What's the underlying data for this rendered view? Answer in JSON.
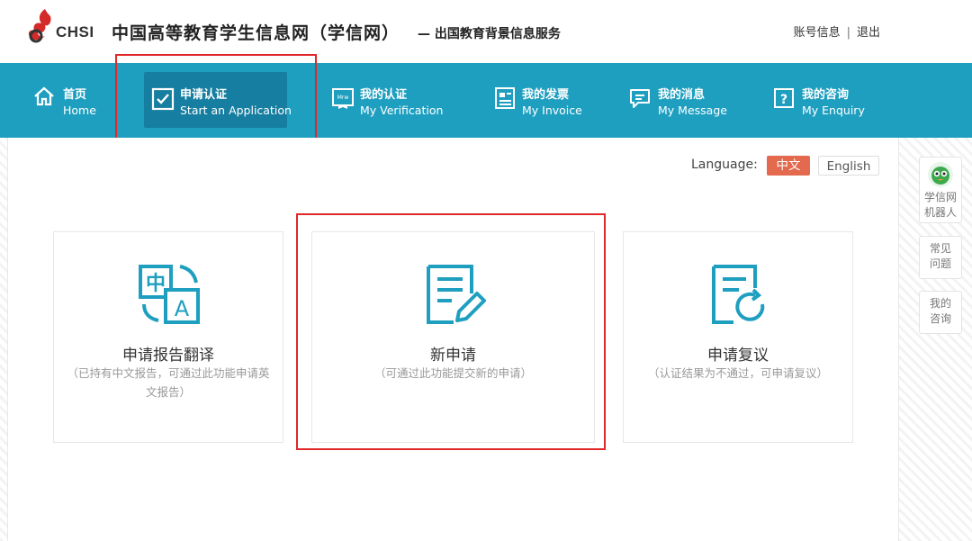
{
  "header": {
    "logo_text": "CHSI",
    "site_title": "中国高等教育学生信息网（学信网）",
    "site_subtitle": "— 出国教育背景信息服务",
    "account_link": "账号信息",
    "separator": "|",
    "logout_link": "退出"
  },
  "nav": {
    "items": [
      {
        "zh": "首页",
        "en": "Home",
        "icon": "home-icon"
      },
      {
        "zh": "申请认证",
        "en": "Start an Application",
        "icon": "checkbox-icon"
      },
      {
        "zh": "我的认证",
        "en": "My Verification",
        "icon": "certificate-icon"
      },
      {
        "zh": "我的发票",
        "en": "My Invoice",
        "icon": "invoice-icon"
      },
      {
        "zh": "我的消息",
        "en": "My Message",
        "icon": "message-icon"
      },
      {
        "zh": "我的咨询",
        "en": "My Enquiry",
        "icon": "enquiry-icon"
      }
    ],
    "active_index": 1
  },
  "language": {
    "label": "Language:",
    "zh": "中文",
    "en": "English",
    "selected": "中文"
  },
  "cards": [
    {
      "title": "申请报告翻译",
      "desc": "（已持有中文报告，可通过此功能申请英文报告）",
      "icon": "translate-icon"
    },
    {
      "title": "新申请",
      "desc": "（可通过此功能提交新的申请）",
      "icon": "new-application-icon"
    },
    {
      "title": "申请复议",
      "desc": "（认证结果为不通过，可申请复议）",
      "icon": "review-icon"
    }
  ],
  "side": {
    "robot": "学信网机器人",
    "faq": "常见问题",
    "consult": "我的咨询"
  },
  "colors": {
    "nav_bg": "#1f9fc0",
    "nav_active": "#167ea0",
    "accent_teal": "#1f9fc0",
    "lang_active": "#e36a4f",
    "highlight": "#e0282a"
  }
}
